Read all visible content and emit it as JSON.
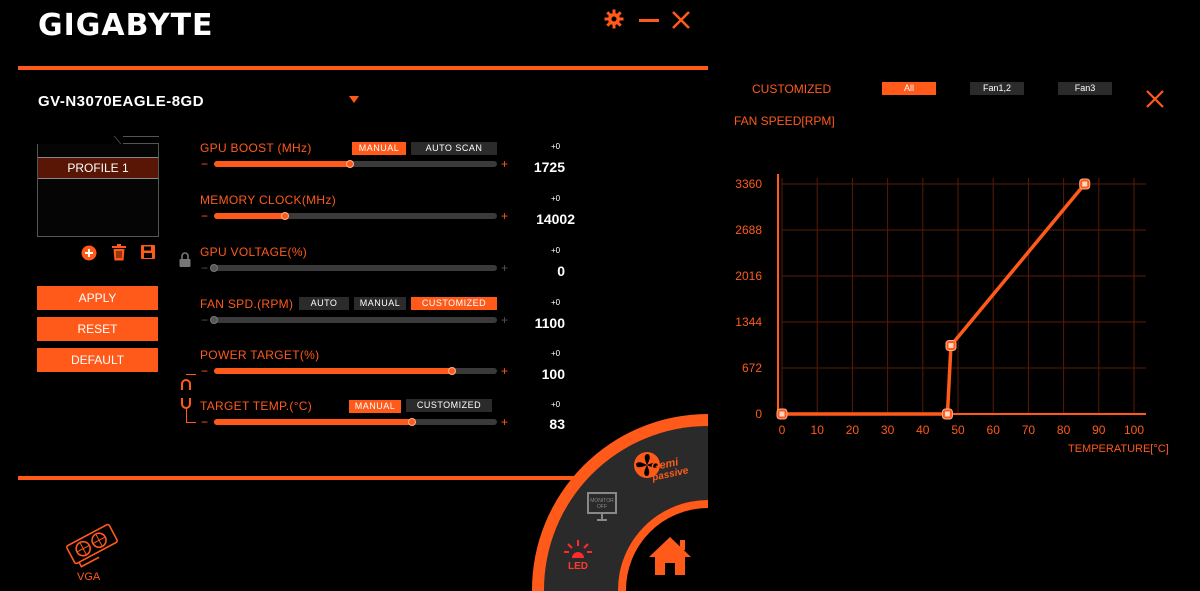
{
  "header": {
    "logo": "GIGABYTE"
  },
  "device": {
    "model": "GV-N3070EAGLE-8GD"
  },
  "profiles": {
    "items": [
      "PROFILE 1"
    ]
  },
  "actions": {
    "apply": "APPLY",
    "reset": "RESET",
    "default": "DEFAULT"
  },
  "controls": {
    "gpu_boost": {
      "label": "GPU BOOST (MHz)",
      "mode1": "MANUAL",
      "mode2": "AUTO SCAN",
      "delta": "+0",
      "value": "1725",
      "level": 0.48
    },
    "memory_clock": {
      "label": "MEMORY CLOCK(MHz)",
      "delta": "+0",
      "value": "14002",
      "level": 0.25
    },
    "gpu_voltage": {
      "label": "GPU VOLTAGE(%)",
      "delta": "+0",
      "value": "0",
      "level": 0.0
    },
    "fan_speed": {
      "label": "FAN SPD.(RPM)",
      "mode1": "AUTO",
      "mode2": "MANUAL",
      "mode3": "CUSTOMIZED",
      "delta": "+0",
      "value": "1100",
      "level": 0.0
    },
    "power_target": {
      "label": "POWER TARGET(%)",
      "delta": "+0",
      "value": "100",
      "level": 0.84
    },
    "target_temp": {
      "label": "TARGET TEMP.(°C)",
      "mode1": "MANUAL",
      "mode2": "CUSTOMIZED",
      "delta": "+0",
      "value": "83",
      "level": 0.7
    }
  },
  "bottom_nav": {
    "vga": "VGA",
    "led": "LED",
    "monitor": "MONITOR OFF",
    "gemi_line1": "Gemi",
    "gemi_line2": "passive"
  },
  "fan_panel": {
    "title": "CUSTOMIZED",
    "tabs": [
      "All",
      "Fan1,2",
      "Fan3"
    ],
    "active_tab": "All",
    "ylabel": "FAN SPEED[RPM]",
    "xlabel": "TEMPERATURE[°C]"
  },
  "colors": {
    "accent": "#ff5a1a",
    "background": "#000000",
    "panel_dark": "#2b2b2b"
  },
  "chart_data": {
    "type": "line",
    "title": "",
    "xlabel": "TEMPERATURE[°C]",
    "ylabel": "FAN SPEED[RPM]",
    "x_ticks": [
      0,
      10,
      20,
      30,
      40,
      50,
      60,
      70,
      80,
      90,
      100
    ],
    "y_ticks": [
      0,
      672,
      1344,
      2016,
      2688,
      3360
    ],
    "xlim": [
      0,
      100
    ],
    "ylim": [
      0,
      3360
    ],
    "grid": true,
    "series": [
      {
        "x": [
          0,
          47,
          48,
          86
        ],
        "y": [
          0,
          0,
          1000,
          3360
        ]
      }
    ]
  }
}
